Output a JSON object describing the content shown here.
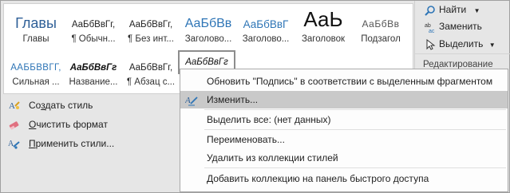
{
  "gallery": {
    "row1": [
      {
        "sample": "Главы",
        "name": "Главы",
        "style": "s-heads"
      },
      {
        "sample": "АаБбВвГг,",
        "name": "¶ Обычн...",
        "style": "s-normal"
      },
      {
        "sample": "АаБбВвГг,",
        "name": "¶ Без инт...",
        "style": "s-normal"
      },
      {
        "sample": "АаБбВв",
        "name": "Заголово...",
        "style": "s-head1"
      },
      {
        "sample": "АаБбВвГ",
        "name": "Заголово...",
        "style": "s-head2"
      },
      {
        "sample": "АаЬ",
        "name": "Заголовок",
        "style": "s-title"
      },
      {
        "sample": "АаБбВв",
        "name": "Подзагол",
        "style": "s-subtitle"
      }
    ],
    "row2": [
      {
        "sample": "ААББВВГГ,",
        "name": "Сильная ...",
        "style": "s-strong"
      },
      {
        "sample": "АаБбВвГг",
        "name": "Название...",
        "style": "s-bookt"
      },
      {
        "sample": "АаБбВвГг,",
        "name": "¶ Абзац с...",
        "style": "s-plain"
      },
      {
        "sample": "АаБбВвГг",
        "name": "",
        "style": "s-sig"
      }
    ]
  },
  "left_actions": [
    {
      "label": "Создать стиль",
      "accel": "з",
      "icon": "new-style-icon"
    },
    {
      "label": "Очистить формат",
      "accel": "О",
      "icon": "clear-format-icon"
    },
    {
      "label": "Применить стили...",
      "accel": "П",
      "icon": "apply-styles-icon"
    }
  ],
  "editing": {
    "find": "Найти",
    "replace": "Заменить",
    "select": "Выделить",
    "group_label": "Редактирование"
  },
  "context_menu": {
    "items": [
      {
        "label": "Обновить \"Подпись\" в соответствии с выделенным фрагментом",
        "highlighted": false
      },
      {
        "label": "Изменить...",
        "highlighted": true
      },
      {
        "label": "Выделить все: (нет данных)",
        "highlighted": false
      },
      {
        "label": "Переименовать...",
        "highlighted": false
      },
      {
        "label": "Удалить из коллекции стилей",
        "highlighted": false
      },
      {
        "label": "Добавить коллекцию на панель быстрого доступа",
        "highlighted": false
      }
    ]
  },
  "colors": {
    "accent": "#2e75b6",
    "highlight": "#c9c9c9"
  }
}
